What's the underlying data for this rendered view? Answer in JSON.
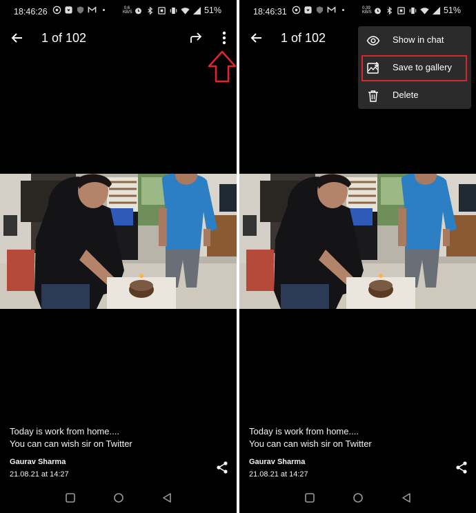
{
  "left": {
    "status_time": "18:46:26",
    "battery": "51%",
    "counter": "1 of 102"
  },
  "right": {
    "status_time": "18:46:31",
    "battery": "51%",
    "counter": "1 of 102"
  },
  "menu": {
    "items": [
      {
        "label": "Show in chat",
        "icon": "eye-icon"
      },
      {
        "label": "Save to gallery",
        "icon": "save-gallery-icon",
        "highlighted": true
      },
      {
        "label": "Delete",
        "icon": "trash-icon"
      }
    ],
    "highlight_color": "#d8262d"
  },
  "message": {
    "caption_line1": "Today is work from home....",
    "caption_line2": "You can can wish sir on Twitter",
    "sender": "Gaurav Sharma",
    "date": "21.08.21 at 14:27"
  },
  "annotation": {
    "arrow_color": "#e0262d"
  },
  "colors": {
    "background": "#000000",
    "menu_bg": "#2b2b2b"
  }
}
